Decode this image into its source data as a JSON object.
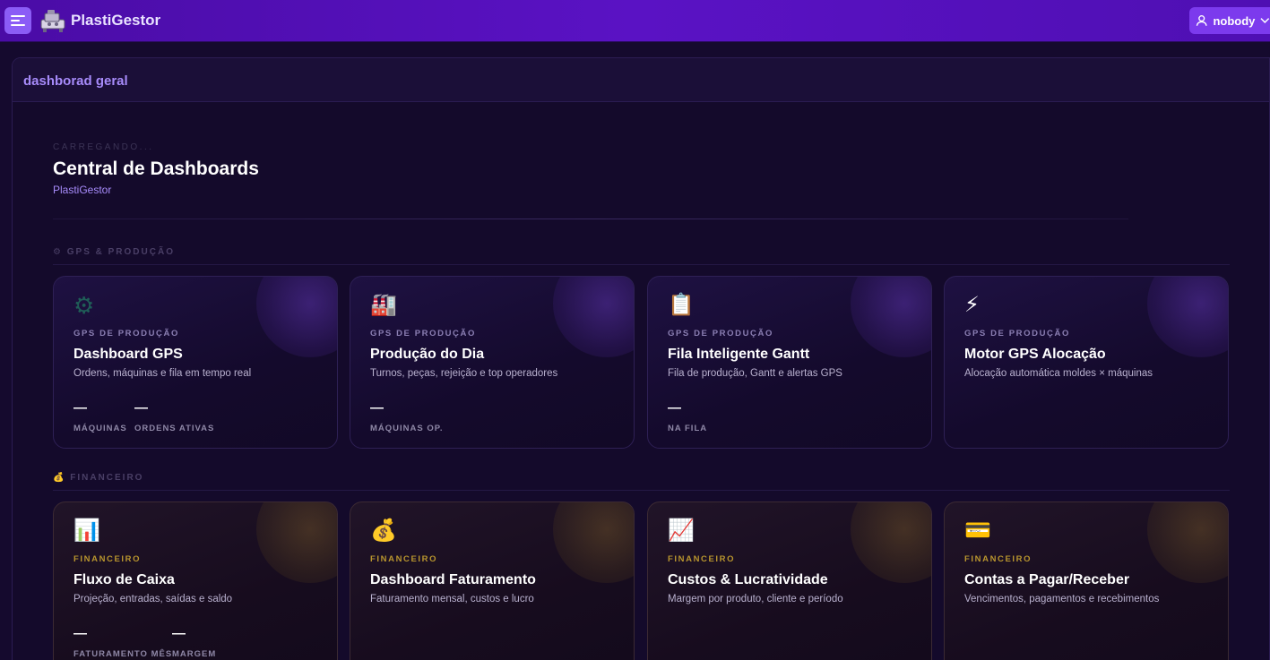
{
  "app": {
    "brand": "PlastiGestor",
    "user": "nobody"
  },
  "panel": {
    "header": "dashborad geral",
    "loading": "CARREGANDO...",
    "title": "Central de Dashboards",
    "subtitle": "PlastiGestor"
  },
  "sections": {
    "gps": "⚙ GPS & PRODUÇÃO",
    "fin": "💰 FINANCEIRO"
  },
  "gps_cards": [
    {
      "icon": "⚙",
      "category": "GPS DE PRODUÇÃO",
      "title": "Dashboard GPS",
      "desc": "Ordens, máquinas e fila em tempo real",
      "metrics": [
        {
          "value": "—",
          "label": "MÁQUINAS"
        },
        {
          "value": "—",
          "label": "ORDENS ATIVAS"
        }
      ]
    },
    {
      "icon": "🏭",
      "category": "GPS DE PRODUÇÃO",
      "title": "Produção do Dia",
      "desc": "Turnos, peças, rejeição e top operadores",
      "metrics": [
        {
          "value": "—",
          "label": "MÁQUINAS OP."
        }
      ]
    },
    {
      "icon": "📋",
      "category": "GPS DE PRODUÇÃO",
      "title": "Fila Inteligente Gantt",
      "desc": "Fila de produção, Gantt e alertas GPS",
      "metrics": [
        {
          "value": "—",
          "label": "NA FILA"
        }
      ]
    },
    {
      "icon": "⚡",
      "category": "GPS DE PRODUÇÃO",
      "title": "Motor GPS Alocação",
      "desc": "Alocação automática moldes × máquinas",
      "metrics": []
    }
  ],
  "fin_cards": [
    {
      "icon": "📊",
      "category": "FINANCEIRO",
      "title": "Fluxo de Caixa",
      "desc": "Projeção, entradas, saídas e saldo",
      "metrics": [
        {
          "value": "—",
          "label": "FATURAMENTO MÊS"
        },
        {
          "value": "—",
          "label": "MARGEM"
        }
      ]
    },
    {
      "icon": "💰",
      "category": "FINANCEIRO",
      "title": "Dashboard Faturamento",
      "desc": "Faturamento mensal, custos e lucro",
      "metrics": []
    },
    {
      "icon": "📈",
      "category": "FINANCEIRO",
      "title": "Custos & Lucratividade",
      "desc": "Margem por produto, cliente e período",
      "metrics": []
    },
    {
      "icon": "💳",
      "category": "FINANCEIRO",
      "title": "Contas a Pagar/Receber",
      "desc": "Vencimentos, pagamentos e recebimentos",
      "metrics": []
    }
  ]
}
